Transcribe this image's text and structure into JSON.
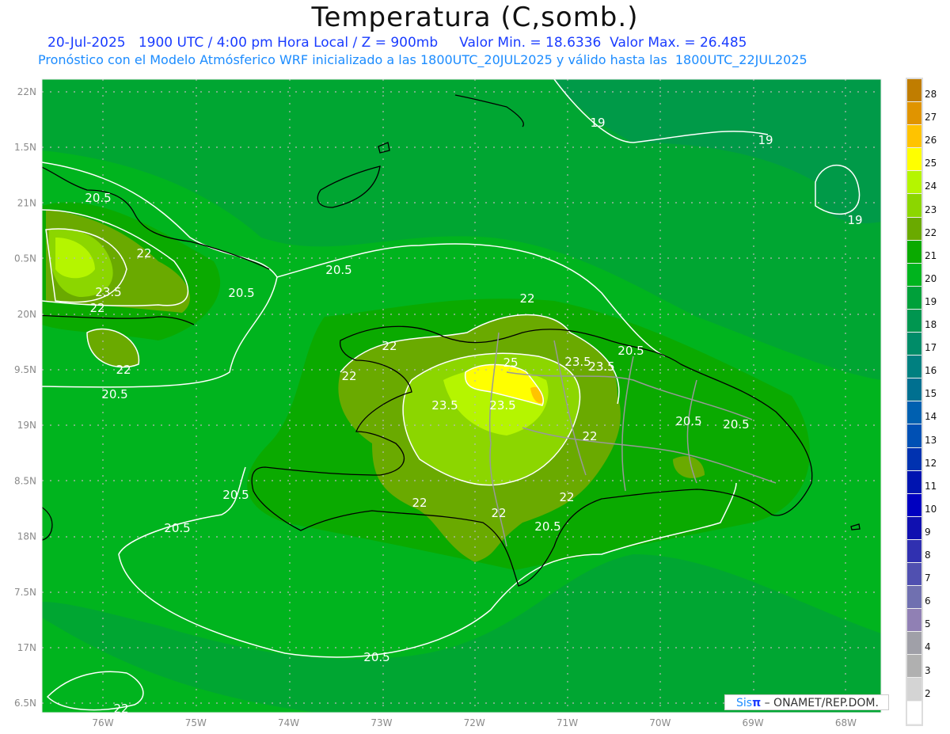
{
  "header": {
    "title": "Temperatura (C,somb.)",
    "subtitle_1": "20-Jul-2025   1900 UTC / 4:00 pm Hora Local / Z = 900mb     Valor Min. = 18.6336  Valor Max. = 26.485",
    "subtitle_2": "Pronóstico con el Modelo Atmósferico WRF inicializado a las 1800UTC_20JUL2025 y válido hasta las  1800UTC_22JUL2025"
  },
  "map": {
    "lat_labels": [
      "22N",
      "1.5N",
      "21N",
      "0.5N",
      "20N",
      "9.5N",
      "19N",
      "8.5N",
      "18N",
      "7.5N",
      "17N",
      "6.5N"
    ],
    "lon_labels": [
      "76W",
      "75W",
      "74W",
      "73W",
      "72W",
      "71W",
      "70W",
      "69W",
      "68W"
    ],
    "lon_range": [
      "76.65W",
      "67.67W"
    ],
    "lat_range": [
      "16.4N",
      "22.1N"
    ],
    "contour_labels": [
      "19",
      "19",
      "19",
      "20.5",
      "20.5",
      "20.5",
      "20.5",
      "20.5",
      "20.5",
      "20.5",
      "20.5",
      "20.5",
      "20.5",
      "20.5",
      "22",
      "22",
      "22",
      "22",
      "22",
      "22",
      "22",
      "22",
      "22",
      "22",
      "23.5",
      "23.5",
      "23.5",
      "23.5",
      "23.5",
      "22",
      "25"
    ]
  },
  "colorbar": {
    "labels": [
      "28",
      "27",
      "26",
      "25",
      "24",
      "23",
      "22",
      "21",
      "20",
      "19",
      "18",
      "17",
      "16",
      "15",
      "14",
      "13",
      "12",
      "11",
      "10",
      "9",
      "8",
      "7",
      "6",
      "5",
      "4",
      "3",
      "2"
    ],
    "colors": [
      "#c07d00",
      "#e09400",
      "#ffc300",
      "#ffff00",
      "#b5f500",
      "#8cd600",
      "#6aaa00",
      "#0aaa00",
      "#00b41e",
      "#00a03a",
      "#009650",
      "#008c68",
      "#008080",
      "#007090",
      "#0060b0",
      "#0050b4",
      "#0032b0",
      "#0014b0",
      "#0000c0",
      "#1010b0",
      "#3030b0",
      "#5050b0",
      "#7070b0",
      "#9080b4",
      "#a0a0a8",
      "#b0b0b0",
      "#d4d4d4",
      "#ffffff"
    ]
  },
  "credit": {
    "sis": "Sis",
    "pi": "π",
    "text": " –  ONAMET/REP.DOM."
  }
}
